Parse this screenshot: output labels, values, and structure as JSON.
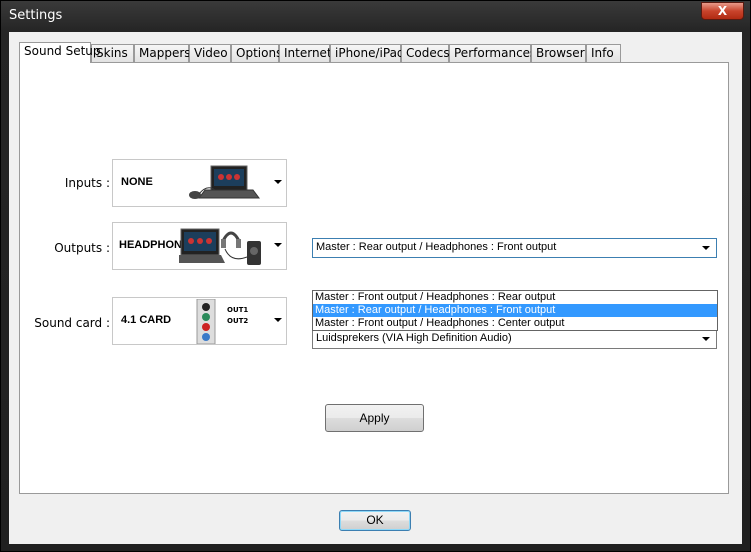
{
  "window": {
    "title": "Settings",
    "close_label": "X"
  },
  "tabs": [
    {
      "label": "Sound Setup",
      "active": true
    },
    {
      "label": "Skins"
    },
    {
      "label": "Mappers"
    },
    {
      "label": "Video"
    },
    {
      "label": "Options"
    },
    {
      "label": "Internet"
    },
    {
      "label": "iPhone/iPad"
    },
    {
      "label": "Codecs"
    },
    {
      "label": "Performances"
    },
    {
      "label": "Browser"
    },
    {
      "label": "Info"
    }
  ],
  "inputs": {
    "label": "Inputs :",
    "value": "NONE"
  },
  "outputs": {
    "label": "Outputs :",
    "value": "HEADPHONES",
    "routing_selected": "Master : Rear output / Headphones : Front output",
    "routing_options": [
      "Master : Front output / Headphones : Rear output",
      "Master : Rear output / Headphones : Front output",
      "Master : Front output / Headphones : Center output"
    ]
  },
  "soundcard": {
    "label": "Sound card :",
    "value": "4.1 CARD",
    "out1": "OUT1",
    "out2": "OUT2",
    "device": "Luidsprekers (VIA High Definition Audio)"
  },
  "buttons": {
    "apply": "Apply",
    "ok": "OK"
  },
  "colors": {
    "selection": "#3399ff",
    "close": "#c8442c"
  }
}
